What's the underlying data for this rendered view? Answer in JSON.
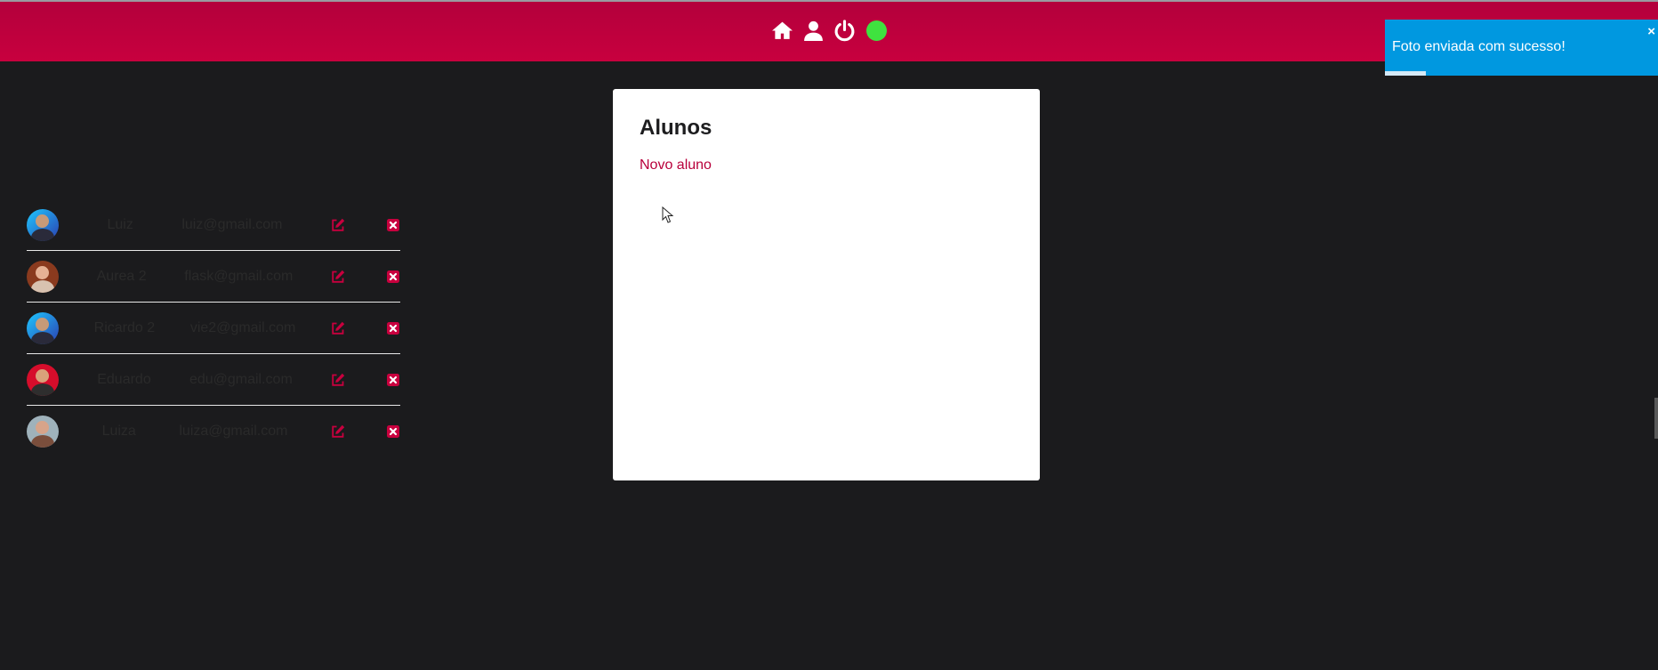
{
  "nav": {
    "icons": [
      "home-icon",
      "user-icon",
      "power-icon",
      "status-dot"
    ],
    "colors": {
      "bar": "#c4003e",
      "status": "#3fe23f"
    }
  },
  "toast": {
    "message": "Foto enviada com sucesso!",
    "close_label": "×",
    "progress": 0.15,
    "color": "#0098e0"
  },
  "card": {
    "title": "Alunos",
    "new_link": "Novo aluno",
    "accent_color": "#b8003b"
  },
  "students": [
    {
      "name": "Luiz",
      "email": "luiz@gmail.com",
      "avatar": "avatar-male-blue"
    },
    {
      "name": "Aurea 2",
      "email": "flask@gmail.com",
      "avatar": "avatar-female-red-hair"
    },
    {
      "name": "Ricardo 2",
      "email": "vie2@gmail.com",
      "avatar": "avatar-male-blue"
    },
    {
      "name": "Eduardo",
      "email": "edu@gmail.com",
      "avatar": "avatar-male-red-bg"
    },
    {
      "name": "Luiza",
      "email": "luiza@gmail.com",
      "avatar": "avatar-female-gray"
    }
  ]
}
